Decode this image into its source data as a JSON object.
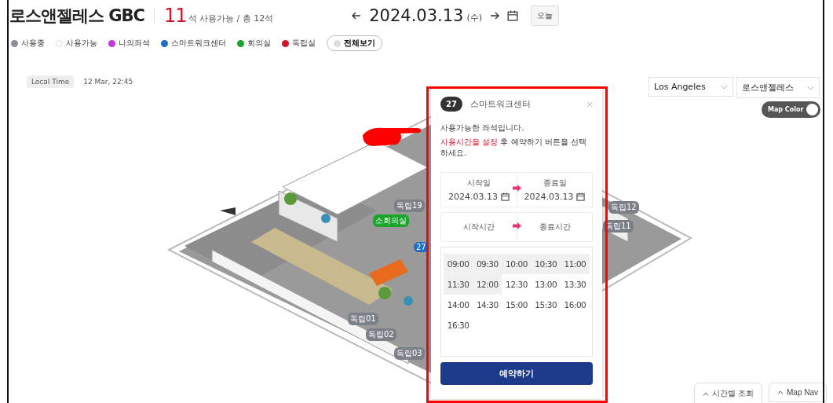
{
  "header": {
    "title": "로스앤젤레스 GBC",
    "available_count": "11",
    "count_text": "석 사용가능 / 총 12석",
    "date": "2024.03.13",
    "weekday": "(수)",
    "today_button": "오늘"
  },
  "legend": [
    {
      "label": "사용중",
      "color": "#8a8f99"
    },
    {
      "label": "사용가능",
      "color": "#ffffff"
    },
    {
      "label": "나의좌석",
      "color": "#c43ad6"
    },
    {
      "label": "스마트워크센터",
      "color": "#1c6fc8"
    },
    {
      "label": "회의실",
      "color": "#1aa52a"
    },
    {
      "label": "독립실",
      "color": "#d3132c"
    }
  ],
  "show_all_button": "전체보기",
  "local_time": {
    "label": "Local Time",
    "value": "12 Mar, 22:45"
  },
  "city_select": "Los Angeles",
  "branch_select": "로스앤젤레스",
  "map_color_toggle": {
    "label": "Map Color",
    "on": true
  },
  "map_labels": [
    {
      "text": "독립19",
      "kind": "room"
    },
    {
      "text": "소회의실",
      "kind": "meeting"
    },
    {
      "text": "27",
      "kind": "smart"
    },
    {
      "text": "독립01",
      "kind": "room"
    },
    {
      "text": "독립02",
      "kind": "room"
    },
    {
      "text": "독립03",
      "kind": "room"
    },
    {
      "text": "독립12",
      "kind": "room"
    },
    {
      "text": "독립11",
      "kind": "room"
    }
  ],
  "popup": {
    "seat_number": "27",
    "seat_type": "스마트워크센터",
    "message": "사용가능한 좌석입니다.",
    "instruction_highlight": "사용시간을 설정",
    "instruction_rest": "후 예약하기 버튼을 선택하세요.",
    "start_date_label": "시작일",
    "start_date": "2024.03.13",
    "end_date_label": "종료일",
    "end_date": "2024.03.13",
    "start_time_label": "시작시간",
    "end_time_label": "종료시간",
    "time_slots": [
      {
        "time": "09:00",
        "past": true
      },
      {
        "time": "09:30",
        "past": true
      },
      {
        "time": "10:00",
        "past": true
      },
      {
        "time": "10:30",
        "past": true
      },
      {
        "time": "11:00",
        "past": true
      },
      {
        "time": "11:30",
        "past": true
      },
      {
        "time": "12:00",
        "past": true
      },
      {
        "time": "12:30",
        "past": false
      },
      {
        "time": "13:00",
        "past": false
      },
      {
        "time": "13:30",
        "past": false
      },
      {
        "time": "14:00",
        "past": false
      },
      {
        "time": "14:30",
        "past": false
      },
      {
        "time": "15:00",
        "past": false
      },
      {
        "time": "15:30",
        "past": false
      },
      {
        "time": "16:00",
        "past": false
      },
      {
        "time": "16:30",
        "past": false
      }
    ],
    "reserve_button": "예약하기"
  },
  "bottom_buttons": [
    "시간별 조회",
    "Map Nav"
  ]
}
